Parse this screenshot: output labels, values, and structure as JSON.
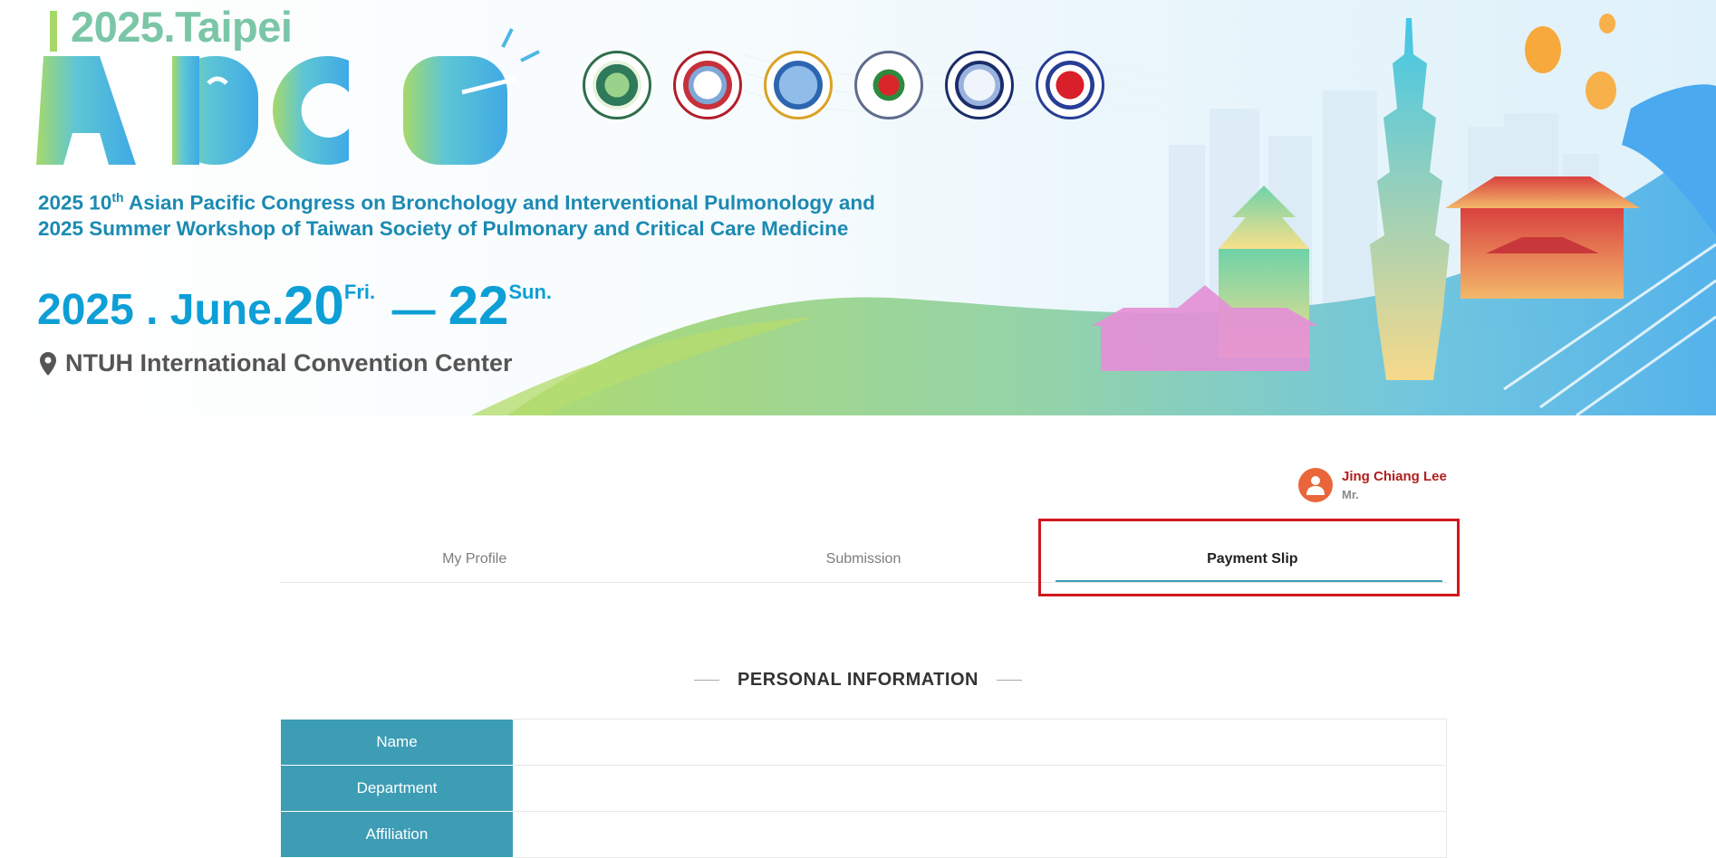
{
  "banner": {
    "city_title": "2025.Taipei",
    "logo_text": "APCB",
    "congress_line1_prefix": "2025 10",
    "congress_line1_sup": "th",
    "congress_line1_rest": " Asian Pacific Congress on Bronchology and Interventional Pulmonology and",
    "congress_line2": "2025 Summer Workshop of Taiwan Society of Pulmonary and Critical Care Medicine",
    "date_year": "2025 . June.",
    "date_start": "20",
    "date_start_day": "Fri.",
    "date_dash": "—",
    "date_end": "22",
    "date_end_day": "Sun.",
    "venue": "NTUH International Convention Center",
    "partner_logos": [
      "tspccm-logo",
      "aabip-logo",
      "apab-logo",
      "society-heart-logo",
      "thoracic-society-logo",
      "blood-society-logo"
    ]
  },
  "user": {
    "name": "Jing Chiang Lee",
    "title": "Mr."
  },
  "tabs": [
    {
      "label": "My Profile",
      "active": false
    },
    {
      "label": "Submission",
      "active": false
    },
    {
      "label": "Payment Slip",
      "active": true
    }
  ],
  "section": {
    "title": "PERSONAL INFORMATION",
    "rows": [
      {
        "label": "Name",
        "value": ""
      },
      {
        "label": "Department",
        "value": ""
      },
      {
        "label": "Affiliation",
        "value": ""
      }
    ]
  },
  "colors": {
    "accent": "#3d9db5",
    "user_name": "#b21d1d",
    "avatar": "#e8663a",
    "highlight": "#d0171d"
  }
}
